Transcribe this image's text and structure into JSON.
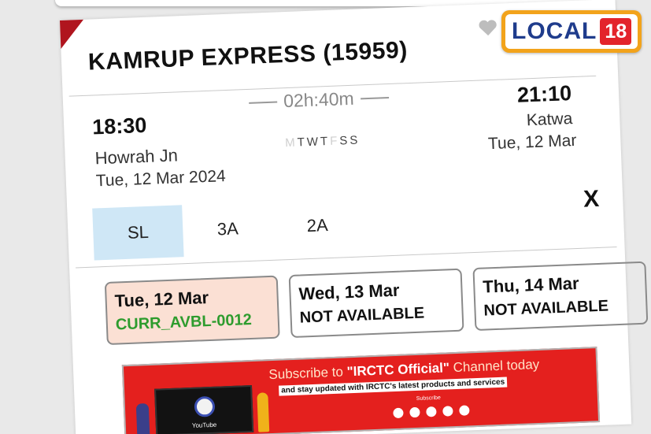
{
  "train": {
    "title": "KAMRUP EXPRESS (15959)"
  },
  "journey": {
    "departure": {
      "time": "18:30",
      "station": "Howrah Jn",
      "date": "Tue, 12 Mar  2024"
    },
    "duration": "02h:40m",
    "run_days": {
      "d1": "M",
      "d2": "T",
      "d3": "W",
      "d4": "T",
      "d5": "F",
      "d6": "S",
      "d7": "S"
    },
    "arrival": {
      "time": "21:10",
      "station": "Katwa",
      "date": "Tue, 12 Mar"
    }
  },
  "classes": [
    {
      "label": "SL",
      "active": true
    },
    {
      "label": "3A",
      "active": false
    },
    {
      "label": "2A",
      "active": false
    }
  ],
  "close_label": "X",
  "availability": [
    {
      "date": "Tue, 12 Mar",
      "status": "CURR_AVBL-0012",
      "selected": true
    },
    {
      "date": "Wed, 13 Mar",
      "status": "NOT AVAILABLE",
      "selected": false
    },
    {
      "date": "Thu, 14 Mar",
      "status": "NOT AVAILABLE",
      "selected": false
    }
  ],
  "banner": {
    "headline_pre": "Subscribe to ",
    "headline_channel": "\"IRCTC Official\"",
    "headline_post": " Channel today",
    "subline": "and stay updated with IRCTC's latest products and services",
    "button": "Subscribe",
    "video_label": "YouTube"
  },
  "logo": {
    "text": "LOCAL",
    "number": "18"
  },
  "colors": {
    "accent": "#b0151e",
    "active_tab": "#cfe7f6",
    "available": "#2e9c2e",
    "banner": "#e4201e",
    "logo_blue": "#1f3c8c"
  }
}
